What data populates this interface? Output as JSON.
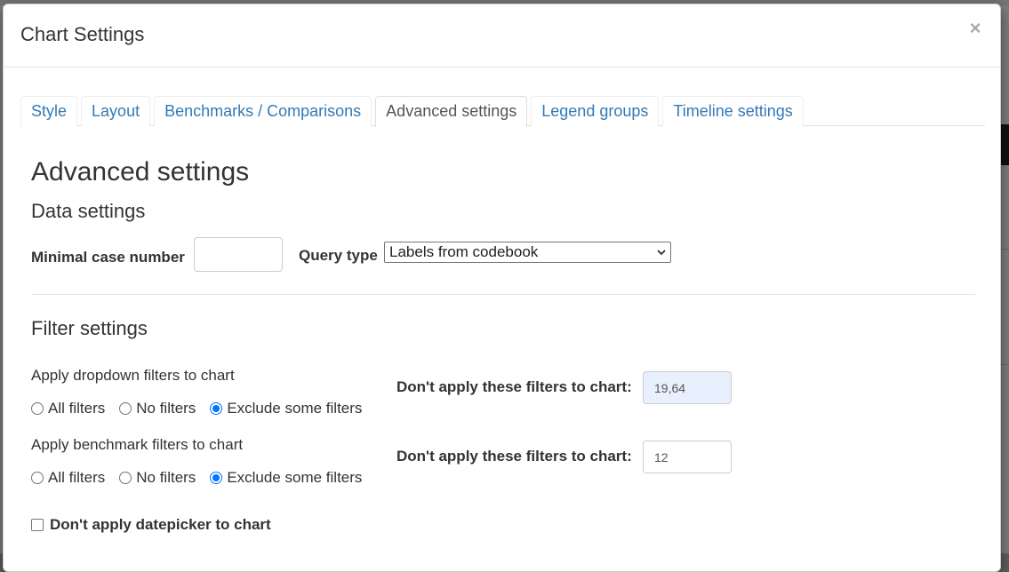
{
  "modal": {
    "title": "Chart Settings",
    "close_symbol": "×"
  },
  "tabs": [
    {
      "label": "Style",
      "active": false
    },
    {
      "label": "Layout",
      "active": false
    },
    {
      "label": "Benchmarks / Comparisons",
      "active": false
    },
    {
      "label": "Advanced settings",
      "active": true
    },
    {
      "label": "Legend groups",
      "active": false
    },
    {
      "label": "Timeline settings",
      "active": false
    }
  ],
  "advanced": {
    "heading": "Advanced settings",
    "data_settings": {
      "heading": "Data settings",
      "min_case_label": "Minimal case number",
      "min_case_value": "",
      "query_type_label": "Query type",
      "query_type_value": "Labels from codebook"
    },
    "filter_settings": {
      "heading": "Filter settings",
      "dropdown": {
        "label": "Apply dropdown filters to chart",
        "options": [
          "All filters",
          "No filters",
          "Exclude some filters"
        ],
        "selected": "Exclude some filters",
        "exclude_label": "Don't apply these filters to chart:",
        "exclude_value": "19,64"
      },
      "benchmark": {
        "label": "Apply benchmark filters to chart",
        "options": [
          "All filters",
          "No filters",
          "Exclude some filters"
        ],
        "selected": "Exclude some filters",
        "exclude_label": "Don't apply these filters to chart:",
        "exclude_value": "12"
      },
      "datepicker_label": "Don't apply datepicker to chart",
      "datepicker_checked": false
    }
  },
  "icons": {
    "close": "close-icon",
    "select_chevron": "chevron-down-icon"
  },
  "colors": {
    "link": "#337ab7",
    "radio_accent": "#0075ff",
    "autofill_bg": "#e8f0fe"
  }
}
